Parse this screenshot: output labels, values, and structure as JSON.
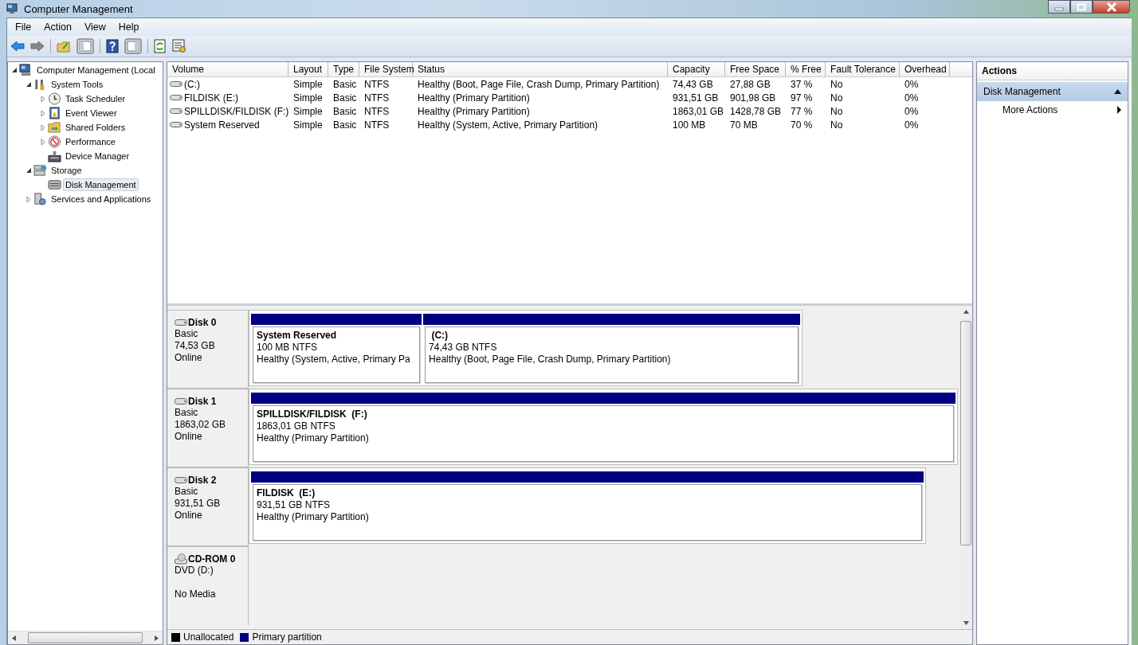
{
  "window": {
    "title": "Computer Management"
  },
  "menu": [
    "File",
    "Action",
    "View",
    "Help"
  ],
  "tree": [
    {
      "label": "Computer Management (Local",
      "expanded": true,
      "selected": false,
      "children": [
        {
          "label": "System Tools",
          "expanded": true,
          "selected": false,
          "children": [
            {
              "label": "Task Scheduler",
              "expanded": false,
              "selected": false
            },
            {
              "label": "Event Viewer",
              "expanded": false,
              "selected": false
            },
            {
              "label": "Shared Folders",
              "expanded": false,
              "selected": false
            },
            {
              "label": "Performance",
              "expanded": false,
              "selected": false
            },
            {
              "label": "Device Manager",
              "selected": false
            }
          ]
        },
        {
          "label": "Storage",
          "expanded": true,
          "selected": false,
          "children": [
            {
              "label": "Disk Management",
              "selected": true
            }
          ]
        },
        {
          "label": "Services and Applications",
          "expanded": false,
          "selected": false
        }
      ]
    }
  ],
  "volumes": {
    "columns": [
      "Volume",
      "Layout",
      "Type",
      "File System",
      "Status",
      "Capacity",
      "Free Space",
      "% Free",
      "Fault Tolerance",
      "Overhead"
    ],
    "rows": [
      [
        "(C:)",
        "Simple",
        "Basic",
        "NTFS",
        "Healthy (Boot, Page File, Crash Dump, Primary Partition)",
        "74,43 GB",
        "27,88 GB",
        "37 %",
        "No",
        "0%"
      ],
      [
        "FILDISK (E:)",
        "Simple",
        "Basic",
        "NTFS",
        "Healthy (Primary Partition)",
        "931,51 GB",
        "901,98 GB",
        "97 %",
        "No",
        "0%"
      ],
      [
        "SPILLDISK/FILDISK (F:)",
        "Simple",
        "Basic",
        "NTFS",
        "Healthy (Primary Partition)",
        "1863,01 GB",
        "1428,78 GB",
        "77 %",
        "No",
        "0%"
      ],
      [
        "System Reserved",
        "Simple",
        "Basic",
        "NTFS",
        "Healthy (System, Active, Primary Partition)",
        "100 MB",
        "70 MB",
        "70 %",
        "No",
        "0%"
      ]
    ]
  },
  "disks": [
    {
      "name": "Disk 0",
      "kind": "disk",
      "type": "Basic",
      "size": "74,53 GB",
      "status": "Online",
      "partitions": [
        {
          "name": "System Reserved",
          "size": "100 MB NTFS",
          "status": "Healthy (System, Active, Primary Pa",
          "color": "#000080"
        },
        {
          "name": " (C:)",
          "size": "74,43 GB NTFS",
          "status": "Healthy (Boot, Page File, Crash Dump, Primary Partition)",
          "color": "#000080"
        }
      ]
    },
    {
      "name": "Disk 1",
      "kind": "disk",
      "type": "Basic",
      "size": "1863,02 GB",
      "status": "Online",
      "partitions": [
        {
          "name": "SPILLDISK/FILDISK  (F:)",
          "size": "1863,01 GB NTFS",
          "status": "Healthy (Primary Partition)",
          "color": "#000080"
        }
      ]
    },
    {
      "name": "Disk 2",
      "kind": "disk",
      "type": "Basic",
      "size": "931,51 GB",
      "status": "Online",
      "partitions": [
        {
          "name": "FILDISK  (E:)",
          "size": "931,51 GB NTFS",
          "status": "Healthy (Primary Partition)",
          "color": "#000080"
        }
      ]
    },
    {
      "name": "CD-ROM 0",
      "kind": "cdrom",
      "type": "DVD (D:)",
      "status": "No Media"
    }
  ],
  "legend": [
    {
      "label": "Unallocated",
      "color": "#000000"
    },
    {
      "label": "Primary partition",
      "color": "#000080"
    }
  ],
  "actions": {
    "title": "Actions",
    "section": "Disk Management",
    "items": [
      "More Actions"
    ]
  }
}
